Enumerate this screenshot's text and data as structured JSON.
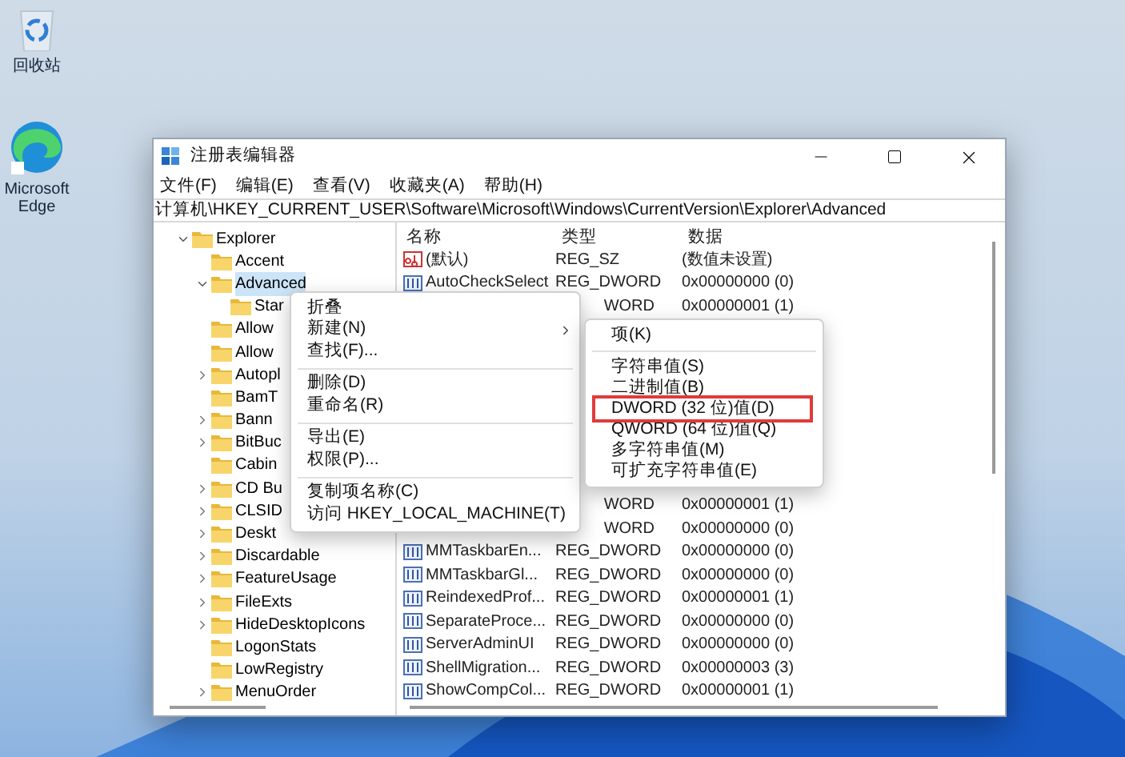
{
  "desktop_icons": [
    {
      "kind": "recycle-bin",
      "label": "回收站"
    },
    {
      "kind": "browser",
      "label": "Microsoft Edge"
    }
  ],
  "window": {
    "title": "注册表编辑器"
  },
  "menu_bar": [
    "文件(F)",
    "编辑(E)",
    "查看(V)",
    "收藏夹(A)",
    "帮助(H)"
  ],
  "address": "计算机\\HKEY_CURRENT_USER\\Software\\Microsoft\\Windows\\CurrentVersion\\Explorer\\Advanced",
  "tree": [
    {
      "label": "Explorer",
      "expandable": true,
      "expanded": true,
      "selected": false,
      "children": [
        {
          "label": "Accent",
          "expandable": false,
          "selected": false
        },
        {
          "label": "Advanced",
          "expandable": true,
          "expanded": true,
          "selected": true,
          "children": [
            {
              "label": "Star",
              "expandable": false,
              "selected": false
            }
          ]
        },
        {
          "label": "Allow",
          "expandable": false,
          "selected": false
        },
        {
          "label": "Allow",
          "expandable": false,
          "selected": false
        },
        {
          "label": "Autopl",
          "expandable": true,
          "expanded": false,
          "selected": false
        },
        {
          "label": "BamT",
          "expandable": false,
          "selected": false
        },
        {
          "label": "Bann",
          "expandable": true,
          "expanded": false,
          "selected": false
        },
        {
          "label": "BitBuc",
          "expandable": true,
          "expanded": false,
          "selected": false
        },
        {
          "label": "Cabin",
          "expandable": false,
          "selected": false
        },
        {
          "label": "CD Bu",
          "expandable": true,
          "expanded": false,
          "selected": false
        },
        {
          "label": "CLSID",
          "expandable": true,
          "expanded": false,
          "selected": false
        },
        {
          "label": "Deskt",
          "expandable": true,
          "expanded": false,
          "selected": false
        },
        {
          "label": "Discardable",
          "expandable": true,
          "expanded": false,
          "selected": false
        },
        {
          "label": "FeatureUsage",
          "expandable": true,
          "expanded": false,
          "selected": false
        },
        {
          "label": "FileExts",
          "expandable": true,
          "expanded": false,
          "selected": false
        },
        {
          "label": "HideDesktopIcons",
          "expandable": true,
          "expanded": false,
          "selected": false
        },
        {
          "label": "LogonStats",
          "expandable": false,
          "selected": false
        },
        {
          "label": "LowRegistry",
          "expandable": false,
          "selected": false
        },
        {
          "label": "MenuOrder",
          "expandable": true,
          "expanded": false,
          "selected": false
        }
      ]
    }
  ],
  "value_list": {
    "columns": [
      "名称",
      "类型",
      "数据"
    ],
    "upper_rows": [
      {
        "kind": "string",
        "name": "(默认)",
        "type": "REG_SZ",
        "data": "(数值未设置)"
      },
      {
        "kind": "number",
        "name": "AutoCheckSelect",
        "type": "REG_DWORD",
        "data": "0x00000000 (0)"
      },
      {
        "kind": "partial",
        "type": "WORD",
        "data": "0x00000001 (1)"
      }
    ],
    "lower_rows": [
      {
        "kind": "partial",
        "type": "WORD",
        "data": "0x00000001 (1)"
      },
      {
        "kind": "partial",
        "type": "WORD",
        "data": "0x00000000 (0)"
      },
      {
        "kind": "number",
        "name": "MMTaskbarEn...",
        "type": "REG_DWORD",
        "data": "0x00000000 (0)"
      },
      {
        "kind": "number",
        "name": "MMTaskbarGl...",
        "type": "REG_DWORD",
        "data": "0x00000000 (0)"
      },
      {
        "kind": "number",
        "name": "ReindexedProf...",
        "type": "REG_DWORD",
        "data": "0x00000001 (1)"
      },
      {
        "kind": "number",
        "name": "SeparateProce...",
        "type": "REG_DWORD",
        "data": "0x00000000 (0)"
      },
      {
        "kind": "number",
        "name": "ServerAdminUI",
        "type": "REG_DWORD",
        "data": "0x00000000 (0)"
      },
      {
        "kind": "number",
        "name": "ShellMigration...",
        "type": "REG_DWORD",
        "data": "0x00000003 (3)"
      },
      {
        "kind": "number",
        "name": "ShowCompCol...",
        "type": "REG_DWORD",
        "data": "0x00000001 (1)"
      }
    ]
  },
  "context_menu": [
    {
      "kind": "item",
      "label": "折叠",
      "submenu": false
    },
    {
      "kind": "item",
      "label": "新建(N)",
      "submenu": true
    },
    {
      "kind": "item",
      "label": "查找(F)...",
      "submenu": false
    },
    {
      "kind": "separator"
    },
    {
      "kind": "item",
      "label": "删除(D)",
      "submenu": false
    },
    {
      "kind": "item",
      "label": "重命名(R)",
      "submenu": false
    },
    {
      "kind": "separator"
    },
    {
      "kind": "item",
      "label": "导出(E)",
      "submenu": false
    },
    {
      "kind": "item",
      "label": "权限(P)...",
      "submenu": false
    },
    {
      "kind": "separator"
    },
    {
      "kind": "item",
      "label": "复制项名称(C)",
      "submenu": false
    },
    {
      "kind": "item",
      "label": "访问 HKEY_LOCAL_MACHINE(T)",
      "submenu": false
    }
  ],
  "submenu": [
    {
      "kind": "item",
      "label": "项(K)",
      "highlighted": false
    },
    {
      "kind": "separator"
    },
    {
      "kind": "item",
      "label": "字符串值(S)",
      "highlighted": false
    },
    {
      "kind": "item",
      "label": "二进制值(B)",
      "highlighted": false
    },
    {
      "kind": "item",
      "label": "DWORD (32 位)值(D)",
      "highlighted": true
    },
    {
      "kind": "item",
      "label": "QWORD (64 位)值(Q)",
      "highlighted": false
    },
    {
      "kind": "item",
      "label": "多字符串值(M)",
      "highlighted": false
    },
    {
      "kind": "item",
      "label": "可扩充字符串值(E)",
      "highlighted": false
    }
  ]
}
